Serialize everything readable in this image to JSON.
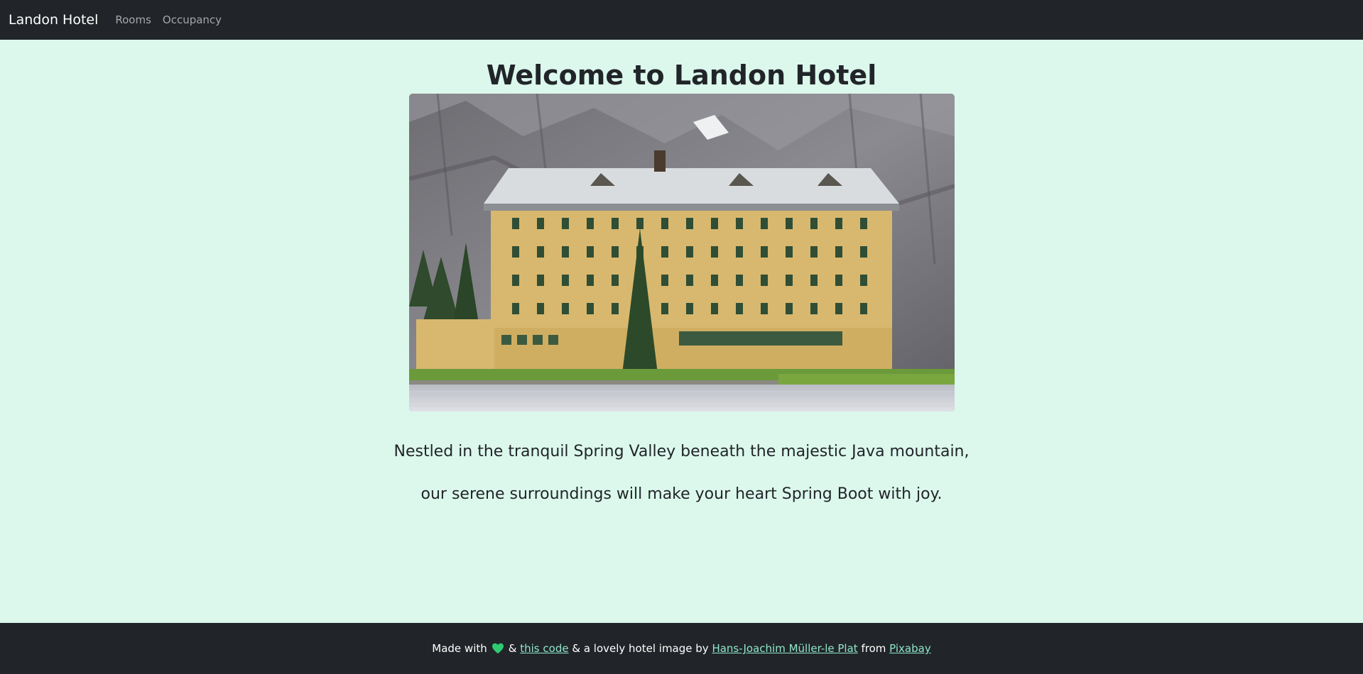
{
  "navbar": {
    "brand": "Landon Hotel",
    "links": [
      "Rooms",
      "Occupancy"
    ]
  },
  "main": {
    "title": "Welcome to Landon Hotel",
    "image_alt": "Landon Hotel building by a mountain lake",
    "tagline_line1": "Nestled in the tranquil Spring Valley beneath the majestic Java mountain,",
    "tagline_line2": "our serene surroundings will make your heart Spring Boot with joy."
  },
  "footer": {
    "made_with": "Made with",
    "amp1": "&",
    "code_link": "this code",
    "mid_text": "& a lovely hotel image by",
    "author_link": "Hans-Joachim Müller-le Plat",
    "from_text": "from",
    "source_link": "Pixabay"
  },
  "colors": {
    "page_background": "#dcf8ec",
    "navbar_background": "#212529",
    "footer_link": "#8fe6c8",
    "heart": "#2ecc71"
  },
  "icons": {
    "heart": "heart-icon"
  }
}
